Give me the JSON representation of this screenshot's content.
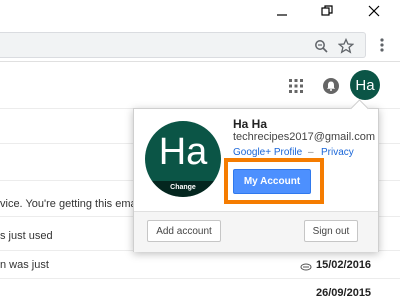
{
  "window": {
    "controls": [
      "minimize",
      "restore",
      "close"
    ]
  },
  "toolbar": {
    "icons": [
      "zoom-icon",
      "star-icon",
      "kebab-menu-icon"
    ]
  },
  "header": {
    "icons": [
      "apps-grid-icon",
      "notifications-icon"
    ],
    "avatar_initials": "Ha"
  },
  "account_popup": {
    "avatar_initials": "Ha",
    "change_label": "Change",
    "name": "Ha Ha",
    "email": "techrecipes2017@gmail.com",
    "profile_link": "Google+ Profile",
    "separator": "–",
    "privacy_link": "Privacy",
    "my_account_label": "My Account",
    "add_account_label": "Add account",
    "sign_out_label": "Sign out"
  },
  "email_list": {
    "rows": [
      {
        "snippet": "vice. You're getting this email to",
        "date": ""
      },
      {
        "snippet": "s just used",
        "date": ""
      },
      {
        "snippet": "n was just",
        "date": "15/02/2016"
      },
      {
        "snippet": "",
        "date": "26/09/2015"
      }
    ]
  },
  "colors": {
    "avatar_bg": "#0b5546",
    "primary_button": "#4d90fe",
    "highlight_border": "#f57c00",
    "link": "#1a66d8"
  }
}
